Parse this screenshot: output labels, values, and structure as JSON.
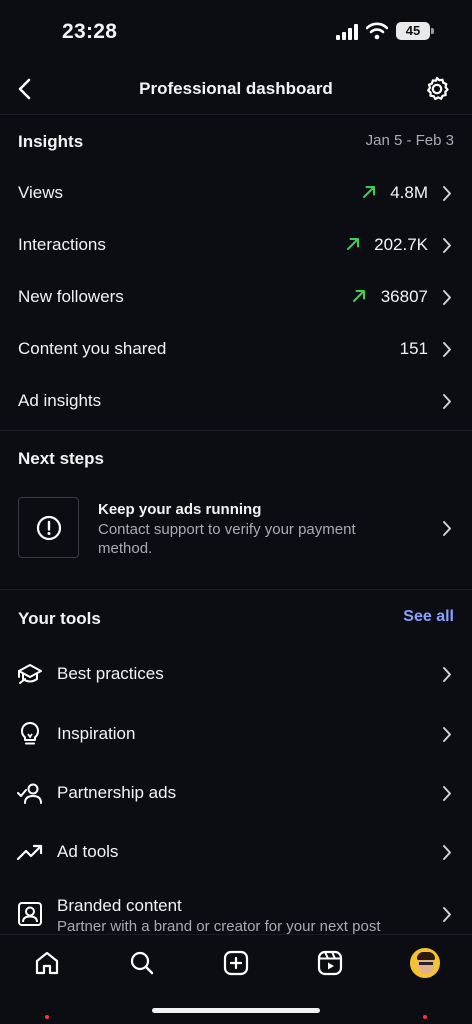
{
  "status_bar": {
    "time": "23:28",
    "battery": "45"
  },
  "header": {
    "title": "Professional dashboard"
  },
  "insights": {
    "title": "Insights",
    "date_range": "Jan 5 - Feb 3",
    "rows": [
      {
        "label": "Views",
        "value": "4.8M",
        "trend": "up"
      },
      {
        "label": "Interactions",
        "value": "202.7K",
        "trend": "up"
      },
      {
        "label": "New followers",
        "value": "36807",
        "trend": "up"
      },
      {
        "label": "Content you shared",
        "value": "151",
        "trend": "none"
      },
      {
        "label": "Ad insights",
        "value": "",
        "trend": "none"
      }
    ]
  },
  "next_steps": {
    "title": "Next steps",
    "card": {
      "title": "Keep your ads running",
      "subtitle": "Contact support to verify your payment method."
    }
  },
  "tools": {
    "title": "Your tools",
    "see_all": "See all",
    "items": [
      {
        "label": "Best practices",
        "icon": "graduation-cap-icon"
      },
      {
        "label": "Inspiration",
        "icon": "lightbulb-icon"
      },
      {
        "label": "Partnership ads",
        "icon": "partnership-icon"
      },
      {
        "label": "Ad tools",
        "icon": "trend-up-icon"
      },
      {
        "label": "Branded content",
        "subtitle": "Partner with a brand or creator for your next post",
        "icon": "branded-content-icon"
      }
    ]
  },
  "tab_bar": {
    "tabs": [
      "home-icon",
      "search-icon",
      "create-icon",
      "reels-icon",
      "profile-avatar"
    ]
  },
  "colors": {
    "background": "#0c0d12",
    "trend_up": "#39d353",
    "link": "#8aa2ff",
    "notification_dot": "#ff3040"
  }
}
